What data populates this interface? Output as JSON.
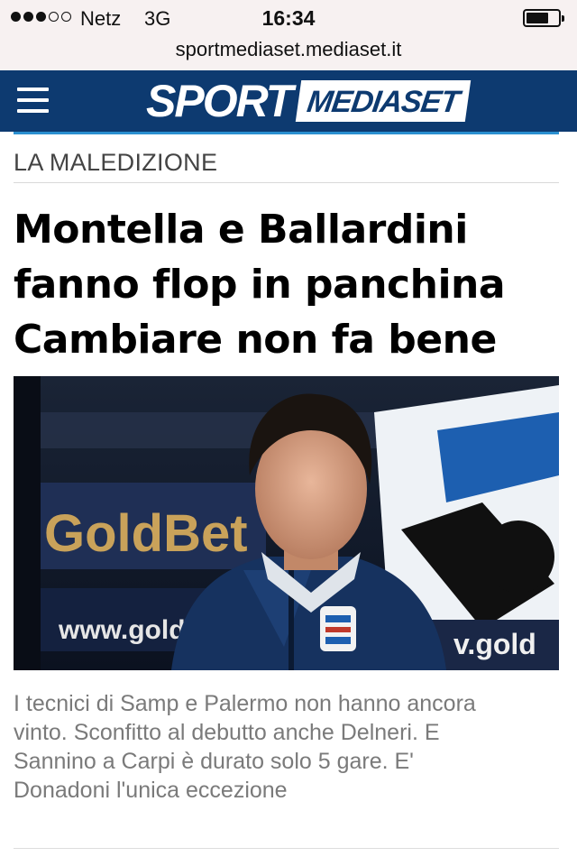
{
  "status_bar": {
    "signal_bars": 3,
    "signal_bars_total": 5,
    "carrier": "Netz",
    "network": "3G",
    "time": "16:34",
    "battery_level": 0.7
  },
  "browser": {
    "url": "sportmediaset.mediaset.it"
  },
  "site": {
    "logo_sport": "SPORT",
    "logo_mediaset": "MEDIASET",
    "brand_color": "#0d3a70",
    "accent_color": "#2a8fd0",
    "menu_icon": "hamburger-icon"
  },
  "article": {
    "kicker": "LA MALEDIZIONE",
    "headline_lines": [
      "Montella e Ballardini",
      "fanno flop in panchina",
      "Cambiare non fa bene"
    ],
    "photo": {
      "banner_text": "GoldBet",
      "url_left": "www.gold",
      "url_right": "v.gold"
    },
    "summary_lines": [
      "I tecnici di Samp e Palermo non hanno ancora",
      "vinto. Sconfitto al debutto anche Delneri. E",
      "Sannino a Carpi è durato solo 5 gare. E'",
      "Donadoni l'unica eccezione"
    ]
  }
}
